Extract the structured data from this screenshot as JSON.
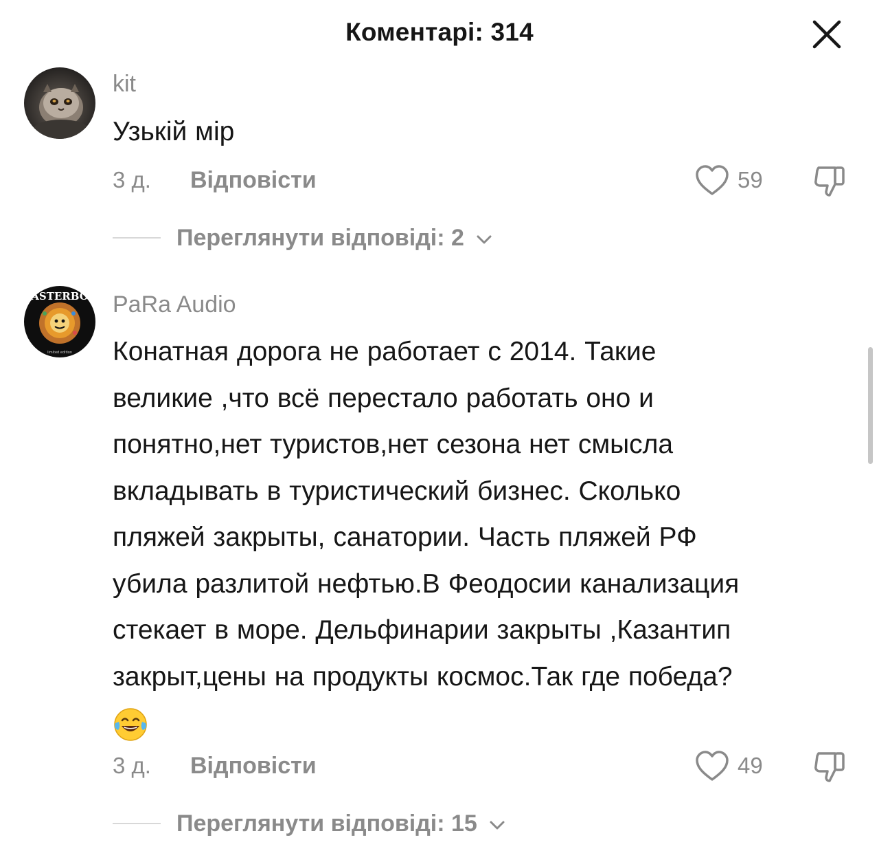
{
  "header": {
    "title": "Коментарі: 314",
    "close_icon": "close-icon"
  },
  "comments": [
    {
      "username": "kit",
      "avatar": "cat-avatar",
      "lines": [
        "Узькій мір"
      ],
      "time": "3 д.",
      "reply_label": "Відповісти",
      "likes": "59",
      "view_replies": "Переглянути відповіді: 2"
    },
    {
      "username": "PaRa Audio",
      "avatar": "record-logo-avatar",
      "avatar_label_top": "ASTERBO",
      "avatar_label_bottom": "limited edition",
      "lines": [
        "Конатная дорога не работает с 2014. Такие",
        "великие ,что всё перестало работать оно и",
        "понятно,нет туристов,нет сезона нет смысла",
        "вкладывать в туристический бизнес. Сколько",
        "пляжей закрыты, санатории. Часть пляжей РФ",
        "убила разлитой нефтью.В Феодосии канализация",
        "стекает в море. Дельфинарии закрыты ,Казантип",
        "закрыт,цены на продукты космос.Так где победа?"
      ],
      "emoji": "laughing-tears-emoji",
      "time": "3 д.",
      "reply_label": "Відповісти",
      "likes": "49",
      "view_replies": "Переглянути відповіді: 15"
    }
  ],
  "colors": {
    "text": "#161616",
    "muted": "#8a8a8a",
    "divider": "#d8d8d8",
    "background": "#ffffff"
  }
}
